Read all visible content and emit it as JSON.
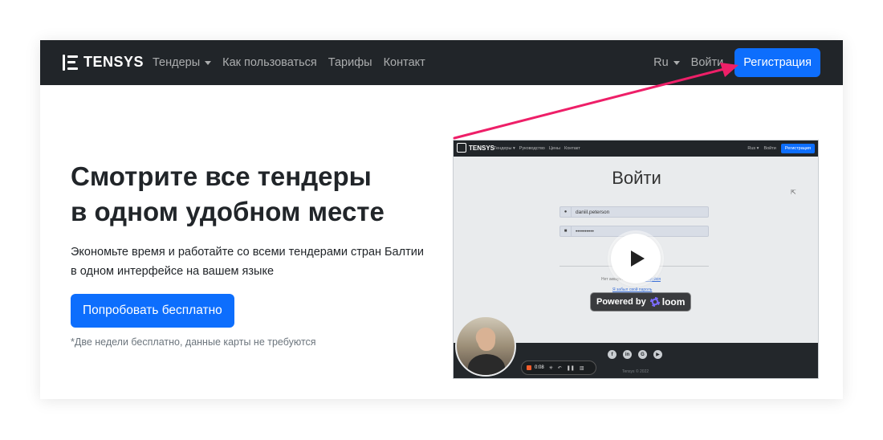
{
  "navbar": {
    "brand": "TENSYS",
    "links": [
      "Тендеры",
      "Как пользоваться",
      "Тарифы",
      "Контакт"
    ],
    "language": "Ru",
    "login": "Войти",
    "register": "Регистрация"
  },
  "hero": {
    "title_line1": "Смотрите все тендеры",
    "title_line2": "в одном удобном месте",
    "subtitle_line1": "Экономьте время и работайте со всеми тендерами стран Балтии",
    "subtitle_line2": "в одном интерфейсе на вашем языке",
    "cta": "Попробовать бесплатно",
    "note": "*Две недели бесплатно, данные карты не требуются"
  },
  "video": {
    "nav_brand": "TENSYS",
    "nav_links": [
      "Тендеры ▾",
      "Руководство",
      "Цены",
      "Контакт"
    ],
    "nav_lang": "Rus ▾",
    "nav_login": "Войти",
    "nav_register": "Регистрация",
    "login_title": "Войти",
    "username": "daniil.peterson",
    "password": "••••••••••",
    "no_account": "Нет аккаунта?",
    "register_link": "Зарегистрируйся",
    "forgot_link": "Я забыл свой пароль",
    "powered_by": "Powered by",
    "loom": "loom",
    "rec_time": "0:08",
    "copyright": "Tensys © 2022"
  },
  "colors": {
    "navbar_bg": "#212529",
    "primary": "#0d6efd",
    "arrow": "#ee1f68"
  }
}
